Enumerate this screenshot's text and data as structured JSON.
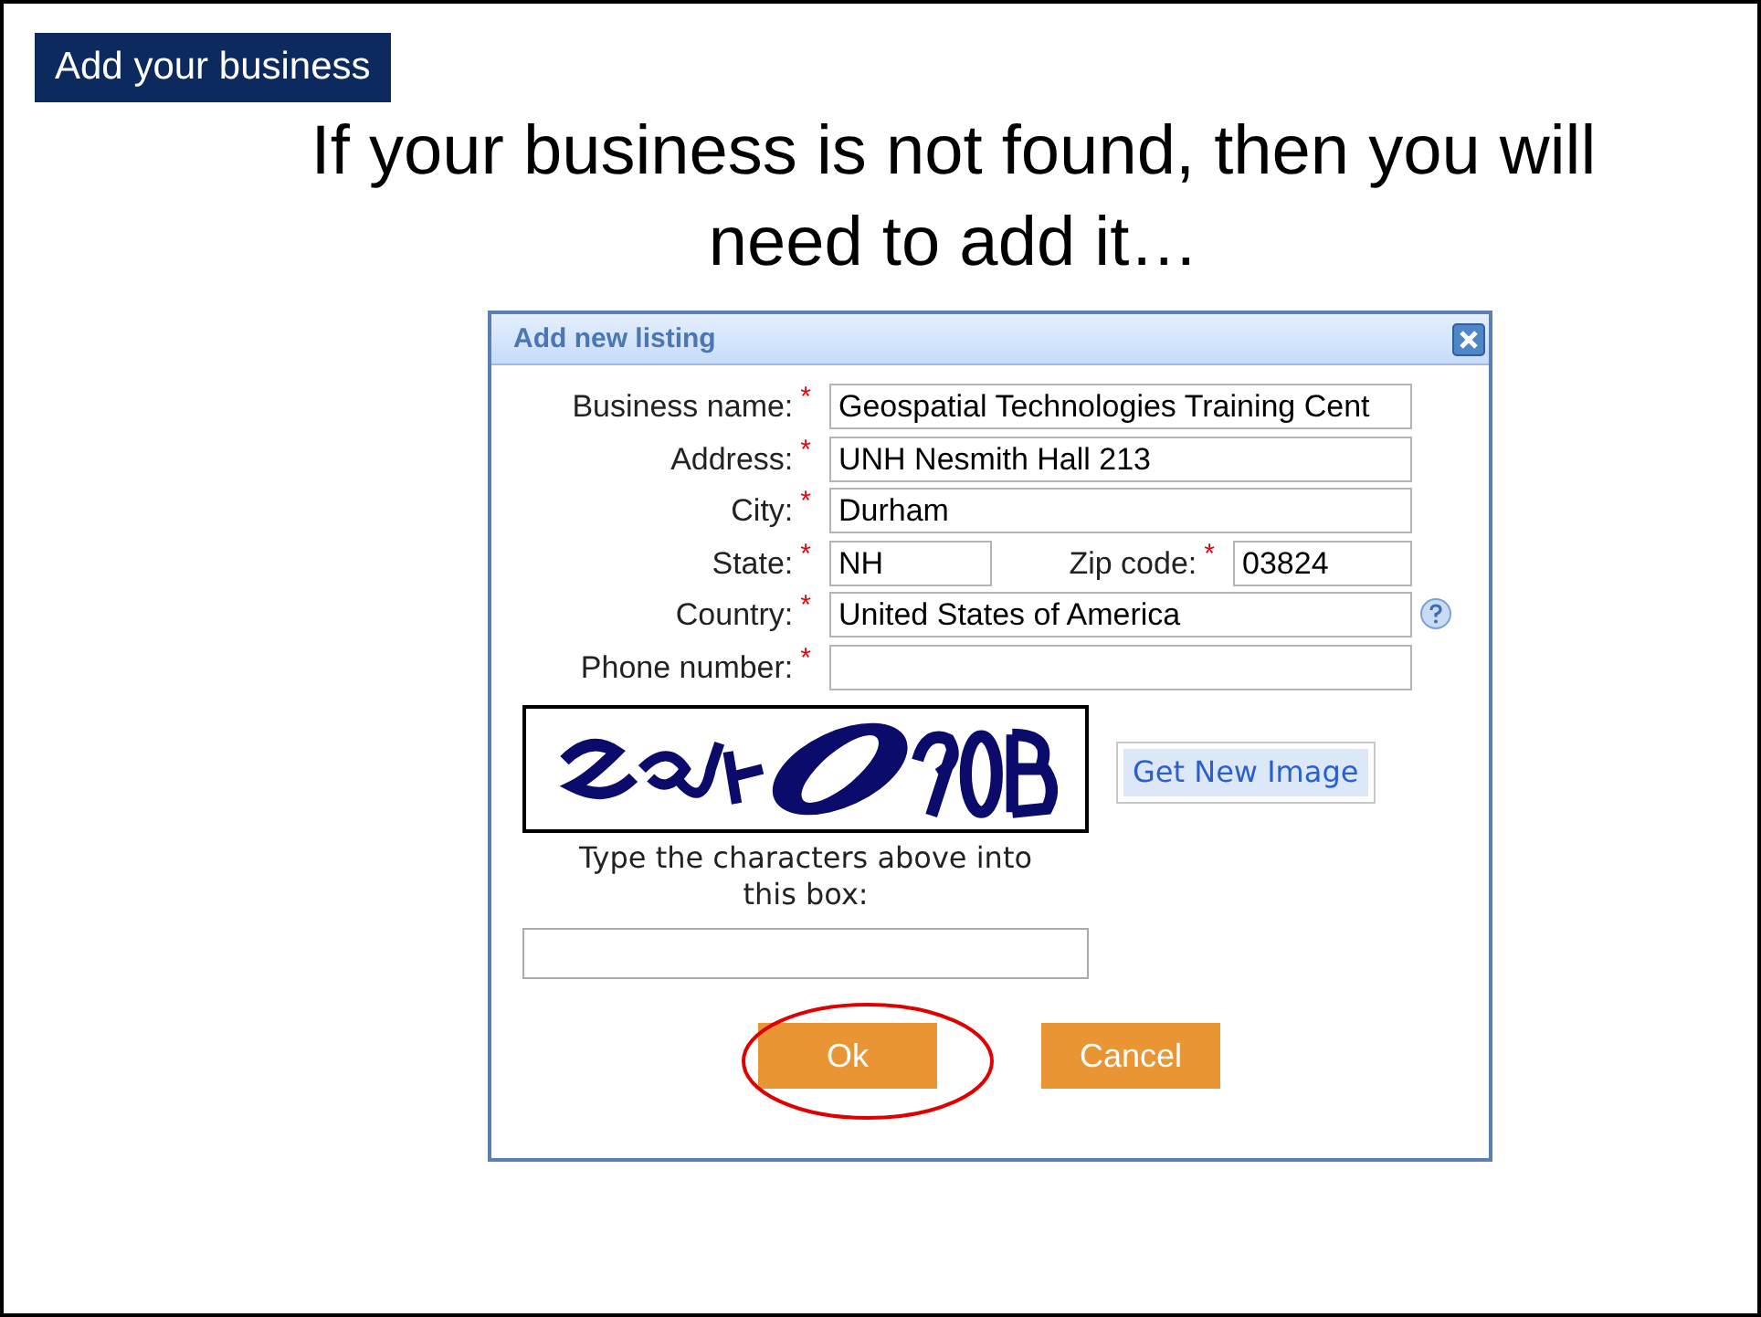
{
  "slide": {
    "tag": "Add your business",
    "heading": "If your business is not found, then you will need to add it…"
  },
  "dialog": {
    "title": "Add new listing",
    "rows": [
      {
        "fields": [
          {
            "label": "Business name:",
            "asterisk": "*",
            "value": "Geospatial Technologies Training Cent"
          }
        ],
        "help": false
      },
      {
        "fields": [
          {
            "label": "Address:",
            "asterisk": "*",
            "value": "UNH Nesmith Hall 213"
          }
        ],
        "help": false
      },
      {
        "fields": [
          {
            "label": "City:",
            "asterisk": "*",
            "value": "Durham"
          }
        ],
        "help": false
      },
      {
        "fields": [
          {
            "label": "State:",
            "asterisk": "*",
            "value": "NH"
          },
          {
            "label": "Zip code:",
            "asterisk": "*",
            "value": "03824"
          }
        ],
        "help": false
      },
      {
        "fields": [
          {
            "label": "Country:",
            "asterisk": "*",
            "value": "United States of America"
          }
        ],
        "help": true
      },
      {
        "fields": [
          {
            "label": "Phone number:",
            "asterisk": "*"
          }
        ],
        "help": false
      }
    ],
    "captcha": {
      "new_image_button": "Get New Image",
      "instruction": "Type the characters above into this box:"
    },
    "buttons": [
      "Ok",
      "Cancel"
    ]
  }
}
